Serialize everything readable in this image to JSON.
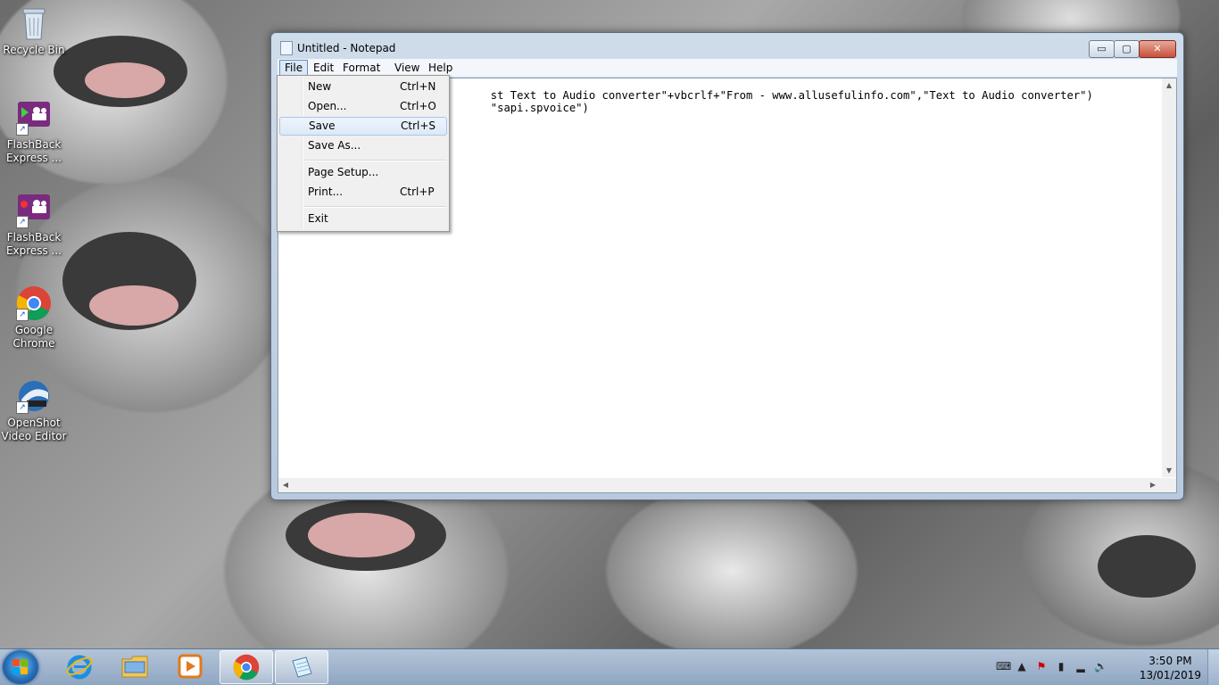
{
  "desktop": {
    "icons": [
      {
        "label_line1": "Recycle Bin",
        "label_line2": ""
      },
      {
        "label_line1": "FlashBack",
        "label_line2": "Express ..."
      },
      {
        "label_line1": "FlashBack",
        "label_line2": "Express ..."
      },
      {
        "label_line1": "Google",
        "label_line2": "Chrome"
      },
      {
        "label_line1": "OpenShot",
        "label_line2": "Video Editor"
      }
    ]
  },
  "window": {
    "title": "Untitled - Notepad",
    "controls": {
      "minimize": "▭",
      "maximize": "▢",
      "close": "✕"
    },
    "menu": [
      "File",
      "Edit",
      "Format",
      "View",
      "Help"
    ],
    "editor_lines": [
      "                                st Text to Audio converter\"+vbcrlf+\"From - www.allusefulinfo.com\",\"Text to Audio converter\")",
      "                                \"sapi.spvoice\")"
    ]
  },
  "file_menu": {
    "items": [
      {
        "label": "New",
        "shortcut": "Ctrl+N"
      },
      {
        "label": "Open...",
        "shortcut": "Ctrl+O"
      },
      {
        "label": "Save",
        "shortcut": "Ctrl+S"
      },
      {
        "label": "Save As...",
        "shortcut": ""
      },
      {
        "label": "Page Setup...",
        "shortcut": ""
      },
      {
        "label": "Print...",
        "shortcut": "Ctrl+P"
      },
      {
        "label": "Exit",
        "shortcut": ""
      }
    ],
    "highlighted": "Save"
  },
  "taskbar": {
    "clock_time": "3:50 PM",
    "clock_date": "13/01/2019"
  },
  "colors": {
    "accent": "#2770b8",
    "menu_highlight": "#dde9f7",
    "close_red": "#c6503b"
  }
}
